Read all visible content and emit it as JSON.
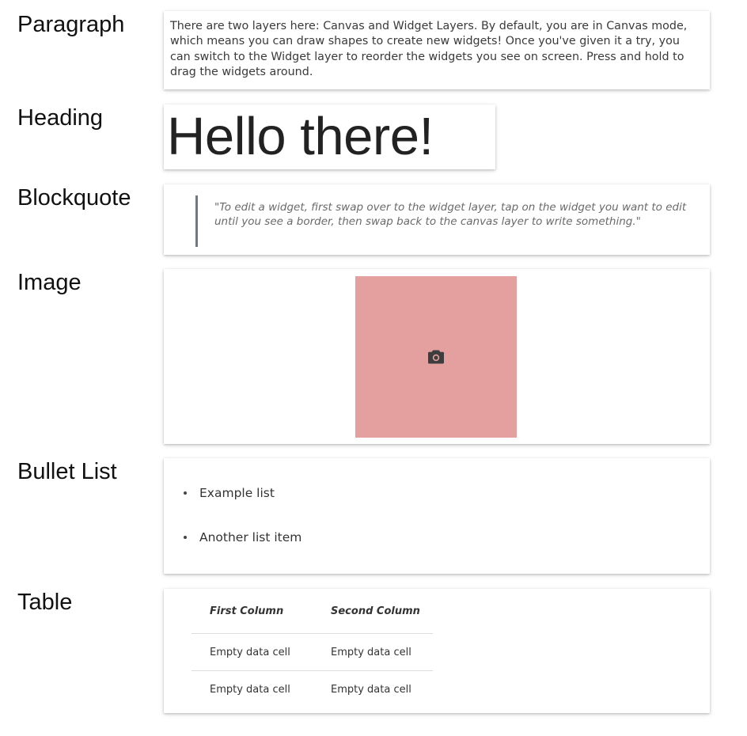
{
  "sections": {
    "paragraph": {
      "label": "Paragraph",
      "text": "There are two layers here: Canvas and Widget Layers. By default, you are in Canvas mode, which means you can draw shapes to create new widgets! Once you've given it a try, you can switch to the Widget layer to reorder the widgets you see on screen. Press and hold to drag the widgets around."
    },
    "heading": {
      "label": "Heading",
      "text": "Hello there!"
    },
    "blockquote": {
      "label": "Blockquote",
      "text": "\"To edit a widget, first swap over to the widget layer, tap on the widget you want to edit until you see a border, then swap back to the canvas layer to write something.\""
    },
    "image": {
      "label": "Image",
      "icon": "camera-icon",
      "placeholder_color": "#e49f9f"
    },
    "bullet_list": {
      "label": "Bullet List",
      "items": [
        "Example list",
        "Another list item"
      ]
    },
    "table": {
      "label": "Table",
      "headers": [
        "First Column",
        "Second Column"
      ],
      "rows": [
        [
          "Empty data cell",
          "Empty data cell"
        ],
        [
          "Empty data cell",
          "Empty data cell"
        ]
      ]
    }
  },
  "colors": {
    "quote_bar": "#6b7a86",
    "image_placeholder": "#e49f9f"
  }
}
